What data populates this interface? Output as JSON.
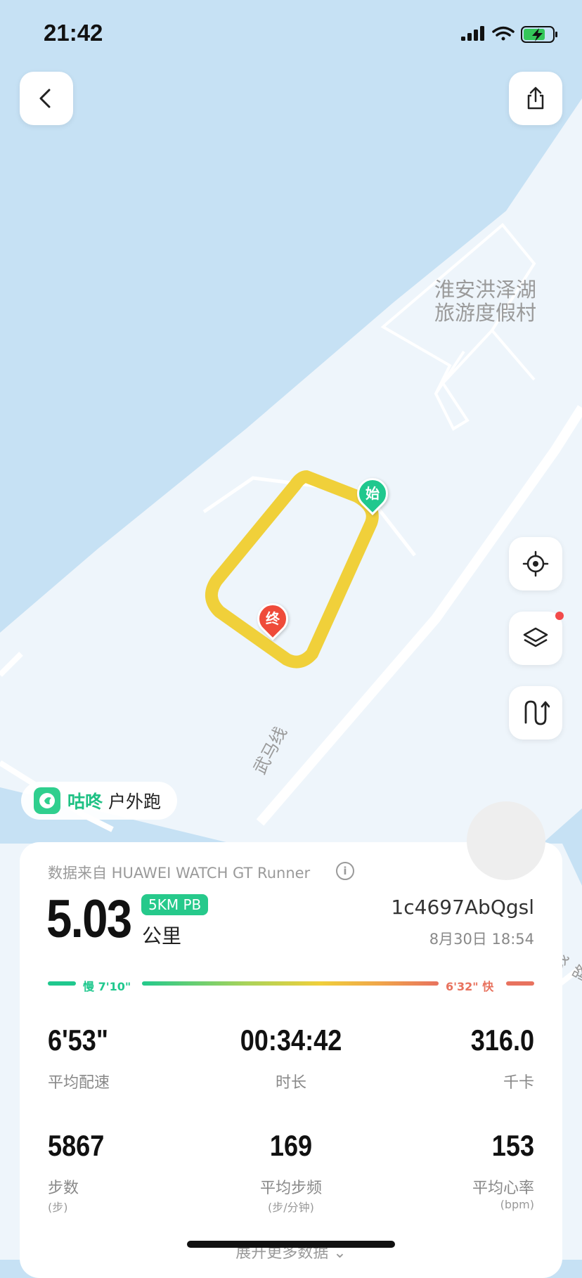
{
  "status_bar": {
    "time": "21:42",
    "signal_icon": "cellular-signal-icon",
    "wifi_icon": "wifi-icon",
    "battery_icon": "battery-charging-icon"
  },
  "toolbar": {
    "back_icon": "back-arrow-icon",
    "share_icon": "share-icon"
  },
  "map": {
    "poi_label_line1": "淮安洪泽湖",
    "poi_label_line2": "旅游度假村",
    "road_label": "武马线",
    "road_label_2": "线路",
    "start_marker": "始",
    "end_marker": "终",
    "route_color": "#f0d03a",
    "water_color": "#c6e1f4",
    "land_color": "#eef5fb"
  },
  "map_controls": {
    "locate_icon": "locate-icon",
    "layers_icon": "layers-icon",
    "track_icon": "track-replay-icon",
    "layers_badge_color": "#f24a4a"
  },
  "app_chip": {
    "app_name": "咕咚",
    "sport": "户外跑",
    "logo_icon": "codoon-logo-icon"
  },
  "summary": {
    "source": "数据来自 HUAWEI WATCH GT Runner",
    "info_icon": "info-icon",
    "distance": "5.03",
    "pb_badge": "5KM PB",
    "distance_unit": "公里",
    "user_id": "1c4697AbQgsl",
    "datetime": "8月30日 18:54"
  },
  "pace_bar": {
    "slow_label": "慢 7'10\"",
    "fast_label": "6'32\" 快"
  },
  "stats": [
    {
      "value": "6'53\"",
      "label": "平均配速",
      "sub": ""
    },
    {
      "value": "00:34:42",
      "label": "时长",
      "sub": ""
    },
    {
      "value": "316.0",
      "label": "千卡",
      "sub": ""
    },
    {
      "value": "5867",
      "label": "步数",
      "sub": "(步)"
    },
    {
      "value": "169",
      "label": "平均步频",
      "sub": "(步/分钟)"
    },
    {
      "value": "153",
      "label": "平均心率",
      "sub": "(bpm)"
    }
  ],
  "expand": {
    "label": "展开更多数据",
    "icon": "chevron-down-icon"
  }
}
